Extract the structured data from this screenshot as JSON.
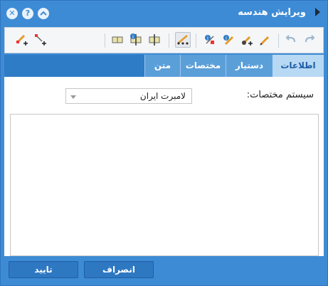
{
  "window": {
    "title": "ویرایش هندسه",
    "controls": [
      "close-icon",
      "help-icon",
      "collapse-icon"
    ]
  },
  "toolbar": {
    "tools": [
      "redo-icon",
      "undo-icon",
      "edit-pencil-icon",
      "add-pencil-icon",
      "info-pencil-icon",
      "info-vertex-icon",
      "vertex-line-icon",
      "split-vertical-icon",
      "info-split-icon",
      "split-box-icon",
      "add-vertex-icon",
      "add-line-icon"
    ]
  },
  "tabs": [
    {
      "label": "اطلاعات",
      "active": true
    },
    {
      "label": "دستیار",
      "active": false
    },
    {
      "label": "مختصات",
      "active": false
    },
    {
      "label": "متن",
      "active": false
    }
  ],
  "form": {
    "coord_system_label": "سیستم مختصات:",
    "coord_system_value": "لامبرت ایران",
    "text_value": ""
  },
  "buttons": {
    "confirm": "تایید",
    "cancel": "انصراف"
  },
  "colors": {
    "title_blue": "#3d8bd5",
    "tab_bar": "#2f7cc6",
    "active_tab": "#b8d9f3",
    "button": "#2e78c2"
  }
}
